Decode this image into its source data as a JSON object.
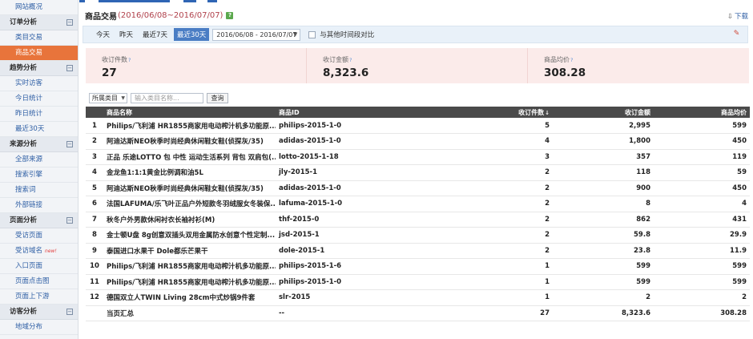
{
  "sidebar": {
    "items": [
      {
        "type": "item",
        "label": "网站概况"
      },
      {
        "type": "group",
        "label": "订单分析",
        "toggle": "⊟"
      },
      {
        "type": "item",
        "label": "类目交易"
      },
      {
        "type": "item",
        "label": "商品交易",
        "active": true
      },
      {
        "type": "group",
        "label": "趋势分析",
        "toggle": "⊟"
      },
      {
        "type": "item",
        "label": "实时访客"
      },
      {
        "type": "item",
        "label": "今日统计"
      },
      {
        "type": "item",
        "label": "昨日统计"
      },
      {
        "type": "item",
        "label": "最近30天"
      },
      {
        "type": "group",
        "label": "来源分析",
        "toggle": "⊟"
      },
      {
        "type": "item",
        "label": "全部来源"
      },
      {
        "type": "item",
        "label": "搜索引擎"
      },
      {
        "type": "item",
        "label": "搜索词"
      },
      {
        "type": "item",
        "label": "外部链接"
      },
      {
        "type": "group",
        "label": "页面分析",
        "toggle": "⊟"
      },
      {
        "type": "item",
        "label": "受访页面"
      },
      {
        "type": "item",
        "label": "受访域名",
        "badge": "new!"
      },
      {
        "type": "item",
        "label": "入口页面"
      },
      {
        "type": "item",
        "label": "页面点击图"
      },
      {
        "type": "item",
        "label": "页面上下游"
      },
      {
        "type": "group",
        "label": "访客分析",
        "toggle": "⊟"
      },
      {
        "type": "item",
        "label": "地域分布"
      }
    ]
  },
  "header": {
    "title": "商品交易",
    "date_range": "(2016/06/08~2016/07/07)",
    "help": "?",
    "download_icon": "⇩",
    "download_label": "下载"
  },
  "filters": {
    "periods": [
      "今天",
      "昨天",
      "最近7天",
      "最近30天"
    ],
    "selected_period": "最近30天",
    "date_value": "2016/06/08 - 2016/07/07",
    "date_caret": "▼",
    "compare_label": "与其他时间段对比",
    "pin_icon": "📌"
  },
  "metrics": [
    {
      "label": "收订件数",
      "value": "27"
    },
    {
      "label": "收订金额",
      "value": "8,323.6"
    },
    {
      "label": "商品均价",
      "value": "308.28"
    }
  ],
  "metric_help": "?",
  "search": {
    "category_label": "所属类目",
    "category_caret": "▼",
    "input_placeholder": "输入类目名称...",
    "query_button": "查询"
  },
  "table": {
    "columns": [
      "",
      "商品名称",
      "商品ID",
      "收订件数",
      "收订金额",
      "商品均价"
    ],
    "sort_icon": "↓",
    "rows": [
      {
        "idx": "1",
        "name": "Philips/飞利浦 HR1855商家用电动榨汁机多功能原...",
        "id": "philips-2015-1-0",
        "qty": "5",
        "amount": "2,995",
        "avg": "599"
      },
      {
        "idx": "2",
        "name": "阿迪达斯NEO秋季时尚经典休闲鞋女鞋(侦探灰/35)",
        "id": "adidas-2015-1-0",
        "qty": "4",
        "amount": "1,800",
        "avg": "450"
      },
      {
        "idx": "3",
        "name": "正品 乐途LOTTO 包 中性 运动生活系列 背包 双肩包(...",
        "id": "lotto-2015-1-18",
        "qty": "3",
        "amount": "357",
        "avg": "119"
      },
      {
        "idx": "4",
        "name": "金龙鱼1:1:1黄金比例调和油5L",
        "id": "jly-2015-1",
        "qty": "2",
        "amount": "118",
        "avg": "59"
      },
      {
        "idx": "5",
        "name": "阿迪达斯NEO秋季时尚经典休闲鞋女鞋(侦探灰/35)",
        "id": "adidas-2015-1-0",
        "qty": "2",
        "amount": "900",
        "avg": "450"
      },
      {
        "idx": "6",
        "name": "法国LAFUMA/乐飞叶正品户外短款冬羽绒服女冬装保...",
        "id": "lafuma-2015-1-0",
        "qty": "2",
        "amount": "8",
        "avg": "4"
      },
      {
        "idx": "7",
        "name": "秋冬户外男款休闲衬衣长袖衬衫(M)",
        "id": "thf-2015-0",
        "qty": "2",
        "amount": "862",
        "avg": "431"
      },
      {
        "idx": "8",
        "name": "金士顿U盘 8g创意双插头双用金属防水创意个性定制...",
        "id": "jsd-2015-1",
        "qty": "2",
        "amount": "59.8",
        "avg": "29.9"
      },
      {
        "idx": "9",
        "name": "泰国进口水果干 Dole都乐芒果干",
        "id": "dole-2015-1",
        "qty": "2",
        "amount": "23.8",
        "avg": "11.9"
      },
      {
        "idx": "10",
        "name": "Philips/飞利浦 HR1855商家用电动榨汁机多功能原...",
        "id": "philips-2015-1-6",
        "qty": "1",
        "amount": "599",
        "avg": "599"
      },
      {
        "idx": "11",
        "name": "Philips/飞利浦 HR1855商家用电动榨汁机多功能原...",
        "id": "philips-2015-1-0",
        "qty": "1",
        "amount": "599",
        "avg": "599"
      },
      {
        "idx": "12",
        "name": "德国双立人TWIN Living 28cm中式炒锅9件套",
        "id": "slr-2015",
        "qty": "1",
        "amount": "2",
        "avg": "2"
      }
    ],
    "summary": {
      "label": "当页汇总",
      "id": "--",
      "qty": "27",
      "amount": "8,323.6",
      "avg": "308.28"
    }
  }
}
